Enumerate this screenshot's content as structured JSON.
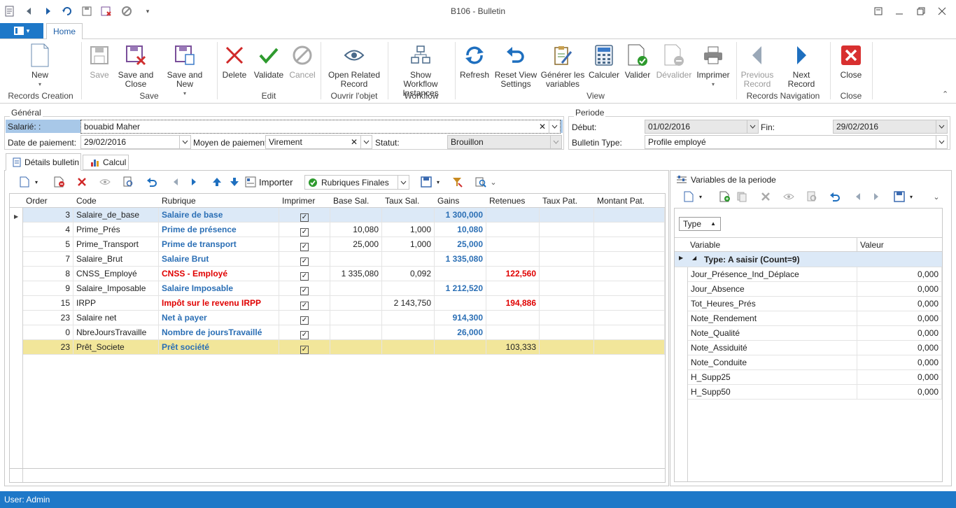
{
  "window": {
    "title": "B106 - Bulletin",
    "tab_home": "Home",
    "status_user": "User: Admin"
  },
  "ribbon": {
    "buttons": {
      "new": "New",
      "save": "Save",
      "save_close": "Save and Close",
      "save_new": "Save and New",
      "delete": "Delete",
      "validate": "Validate",
      "cancel": "Cancel",
      "open_related": "Open Related Record",
      "show_workflow": "Show Workflow Instances",
      "refresh": "Refresh",
      "reset_view": "Reset View Settings",
      "generer": "Générer les variables",
      "calculer": "Calculer",
      "valider": "Valider",
      "devalider": "Dévalider",
      "imprimer": "Imprimer",
      "prev_record": "Previous Record",
      "next_record": "Next Record",
      "close": "Close"
    },
    "groups": {
      "records_creation": "Records Creation",
      "save": "Save",
      "edit": "Edit",
      "ouvrir": "Ouvrir l'objet",
      "workflow": "Workflow",
      "view": "View",
      "records_navigation": "Records Navigation",
      "close": "Close"
    }
  },
  "general": {
    "legend": "Général",
    "salarie_label": "Salarié: :",
    "salarie_value": "bouabid Maher",
    "date_label": "Date de  paiement:",
    "date_value": "29/02/2016",
    "moyen_label": "Moyen de paiement:",
    "moyen_value": "Virement",
    "statut_label": "Statut:",
    "statut_value": "Brouillon"
  },
  "periode": {
    "legend": "Periode",
    "debut_label": "Début:",
    "debut_value": "01/02/2016",
    "fin_label": "Fin:",
    "fin_value": "29/02/2016",
    "type_label": "Bulletin Type:",
    "type_value": "Profile employé"
  },
  "tabs": {
    "details": "Détails bulletin",
    "calcul": "Calcul"
  },
  "toolbar": {
    "importer": "Importer",
    "filter_value": "Rubriques Finales"
  },
  "table": {
    "headers": [
      "Order",
      "Code",
      "Rubrique",
      "Imprimer",
      "Base Sal.",
      "Taux Sal.",
      "Gains",
      "Retenues",
      "Taux Pat.",
      "Montant Pat."
    ],
    "rows": [
      {
        "order": "3",
        "code": "Salaire_de_base",
        "rubrique": "Salaire de base",
        "style": "blue",
        "base": "",
        "taux": "",
        "gains": "1 300,000",
        "retenues": ""
      },
      {
        "order": "4",
        "code": "Prime_Prés",
        "rubrique": "Prime de présence",
        "style": "blue",
        "base": "10,080",
        "taux": "1,000",
        "gains": "10,080",
        "retenues": ""
      },
      {
        "order": "5",
        "code": "Prime_Transport",
        "rubrique": "Prime de transport",
        "style": "blue",
        "base": "25,000",
        "taux": "1,000",
        "gains": "25,000",
        "retenues": ""
      },
      {
        "order": "7",
        "code": "Salaire_Brut",
        "rubrique": "Salaire Brut",
        "style": "blue",
        "base": "",
        "taux": "",
        "gains": "1 335,080",
        "retenues": ""
      },
      {
        "order": "8",
        "code": "CNSS_Employé",
        "rubrique": "CNSS - Employé",
        "style": "red",
        "base": "1 335,080",
        "taux": "0,092",
        "gains": "",
        "retenues": "122,560"
      },
      {
        "order": "9",
        "code": "Salaire_Imposable",
        "rubrique": "Salaire Imposable",
        "style": "blue",
        "base": "",
        "taux": "",
        "gains": "1 212,520",
        "retenues": ""
      },
      {
        "order": "15",
        "code": "IRPP",
        "rubrique": "Impôt sur le revenu IRPP",
        "style": "red",
        "base": "",
        "taux": "2 143,750",
        "gains": "",
        "retenues": "194,886"
      },
      {
        "order": "23",
        "code": "Salaire net",
        "rubrique": "Net à payer",
        "style": "blue",
        "base": "",
        "taux": "",
        "gains": "914,300",
        "retenues": ""
      },
      {
        "order": "0",
        "code": "NbreJoursTravaille",
        "rubrique": "Nombre de joursTravaillé",
        "style": "blue",
        "base": "",
        "taux": "",
        "gains": "26,000",
        "retenues": ""
      },
      {
        "order": "23",
        "code": "Prêt_Societe",
        "rubrique": "Prêt société",
        "style": "blue",
        "base": "",
        "taux": "",
        "gains": "",
        "retenues": "103,333"
      }
    ]
  },
  "variables": {
    "title": "Variables de la periode",
    "group_chip": "Type",
    "col_variable": "Variable",
    "col_valeur": "Valeur",
    "group_row": "Type: A saisir (Count=9)",
    "rows": [
      {
        "name": "Jour_Présence_Ind_Déplace",
        "value": "0,000"
      },
      {
        "name": "Jour_Absence",
        "value": "0,000"
      },
      {
        "name": "Tot_Heures_Prés",
        "value": "0,000"
      },
      {
        "name": "Note_Rendement",
        "value": "0,000"
      },
      {
        "name": "Note_Qualité",
        "value": "0,000"
      },
      {
        "name": "Note_Assiduité",
        "value": "0,000"
      },
      {
        "name": "Note_Conduite",
        "value": "0,000"
      },
      {
        "name": "H_Supp25",
        "value": "0,000"
      },
      {
        "name": "H_Supp50",
        "value": "0,000"
      }
    ]
  },
  "colors": {
    "accent": "#1e78c8",
    "row_selected": "#dce9f7",
    "row_highlight": "#f2e69a",
    "value_blue": "#2b6fb5",
    "value_red": "#e00000"
  }
}
